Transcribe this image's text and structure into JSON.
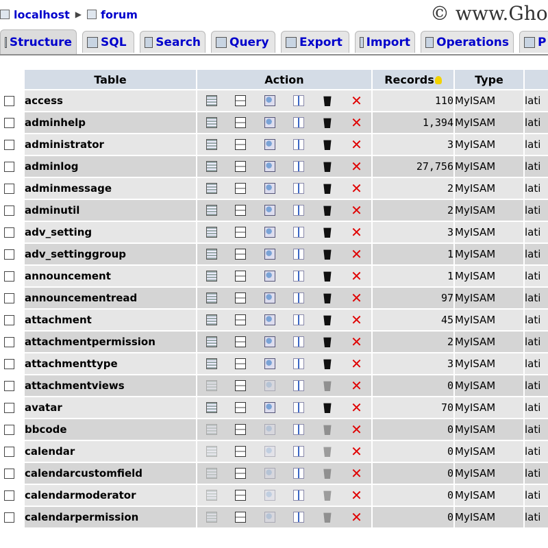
{
  "breadcrumb": {
    "server": "localhost",
    "database": "forum"
  },
  "watermark": "© www.Gho",
  "tabs": [
    {
      "label": "Structure",
      "icon": "structure-icon",
      "active": true
    },
    {
      "label": "SQL",
      "icon": "sql-icon"
    },
    {
      "label": "Search",
      "icon": "search-icon"
    },
    {
      "label": "Query",
      "icon": "query-icon"
    },
    {
      "label": "Export",
      "icon": "export-icon"
    },
    {
      "label": "Import",
      "icon": "import-icon"
    },
    {
      "label": "Operations",
      "icon": "operations-icon"
    },
    {
      "label": "P",
      "icon": "privileges-icon"
    }
  ],
  "columns": {
    "table": "Table",
    "action": "Action",
    "records": "Records",
    "type": "Type"
  },
  "colors": {
    "header_bg": "#d4dce6",
    "row_odd": "#e6e6e6",
    "row_even": "#d5d5d5",
    "link": "#0000cc",
    "drop": "#e00000"
  },
  "rows": [
    {
      "name": "access",
      "records": "110",
      "type": "MyISAM",
      "collation": "lati",
      "empty": false
    },
    {
      "name": "adminhelp",
      "records": "1,394",
      "type": "MyISAM",
      "collation": "lati",
      "empty": false
    },
    {
      "name": "administrator",
      "records": "3",
      "type": "MyISAM",
      "collation": "lati",
      "empty": false
    },
    {
      "name": "adminlog",
      "records": "27,756",
      "type": "MyISAM",
      "collation": "lati",
      "empty": false
    },
    {
      "name": "adminmessage",
      "records": "2",
      "type": "MyISAM",
      "collation": "lati",
      "empty": false
    },
    {
      "name": "adminutil",
      "records": "2",
      "type": "MyISAM",
      "collation": "lati",
      "empty": false
    },
    {
      "name": "adv_setting",
      "records": "3",
      "type": "MyISAM",
      "collation": "lati",
      "empty": false
    },
    {
      "name": "adv_settinggroup",
      "records": "1",
      "type": "MyISAM",
      "collation": "lati",
      "empty": false
    },
    {
      "name": "announcement",
      "records": "1",
      "type": "MyISAM",
      "collation": "lati",
      "empty": false
    },
    {
      "name": "announcementread",
      "records": "97",
      "type": "MyISAM",
      "collation": "lati",
      "empty": false
    },
    {
      "name": "attachment",
      "records": "45",
      "type": "MyISAM",
      "collation": "lati",
      "empty": false
    },
    {
      "name": "attachmentpermission",
      "records": "2",
      "type": "MyISAM",
      "collation": "lati",
      "empty": false
    },
    {
      "name": "attachmenttype",
      "records": "3",
      "type": "MyISAM",
      "collation": "lati",
      "empty": false
    },
    {
      "name": "attachmentviews",
      "records": "0",
      "type": "MyISAM",
      "collation": "lati",
      "empty": true
    },
    {
      "name": "avatar",
      "records": "70",
      "type": "MyISAM",
      "collation": "lati",
      "empty": false
    },
    {
      "name": "bbcode",
      "records": "0",
      "type": "MyISAM",
      "collation": "lati",
      "empty": true
    },
    {
      "name": "calendar",
      "records": "0",
      "type": "MyISAM",
      "collation": "lati",
      "empty": true
    },
    {
      "name": "calendarcustomfield",
      "records": "0",
      "type": "MyISAM",
      "collation": "lati",
      "empty": true
    },
    {
      "name": "calendarmoderator",
      "records": "0",
      "type": "MyISAM",
      "collation": "lati",
      "empty": true
    },
    {
      "name": "calendarpermission",
      "records": "0",
      "type": "MyISAM",
      "collation": "lati",
      "empty": true
    }
  ]
}
